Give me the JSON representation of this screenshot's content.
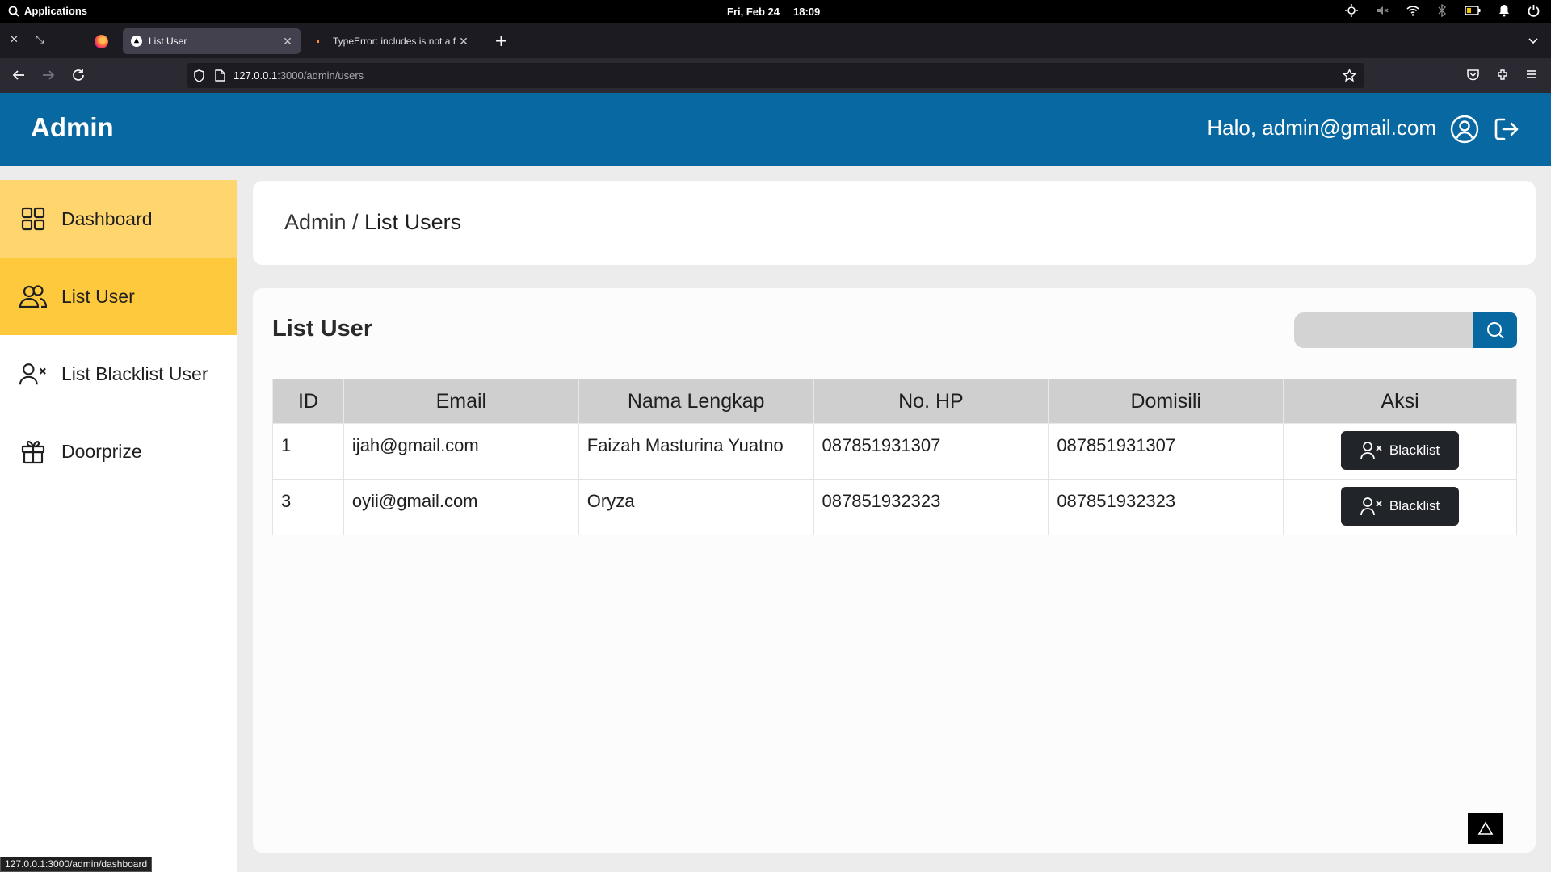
{
  "os": {
    "apps_label": "Applications",
    "date": "Fri, Feb 24",
    "time": "18:09"
  },
  "browser": {
    "tabs": [
      {
        "title": "List User"
      },
      {
        "title": "TypeError: includes is not a fu"
      }
    ],
    "url_host": "127.0.0.1",
    "url_path": ":3000/admin/users",
    "status_url": "127.0.0.1:3000/admin/dashboard"
  },
  "header": {
    "brand": "Admin",
    "greeting": "Halo, admin@gmail.com"
  },
  "sidebar": {
    "items": [
      {
        "label": "Dashboard",
        "icon": "grid-icon"
      },
      {
        "label": "List User",
        "icon": "users-icon"
      },
      {
        "label": "List Blacklist User",
        "icon": "user-x-icon"
      },
      {
        "label": "Doorprize",
        "icon": "gift-icon"
      }
    ]
  },
  "breadcrumb": {
    "root": "Admin / ",
    "current": "List Users"
  },
  "main": {
    "title": "List User",
    "search_placeholder": "",
    "table": {
      "headers": [
        "ID",
        "Email",
        "Nama Lengkap",
        "No. HP",
        "Domisili",
        "Aksi"
      ],
      "rows": [
        {
          "id": "1",
          "email": "ijah@gmail.com",
          "name": "Faizah Masturina Yuatno",
          "phone": "087851931307",
          "domisili": "087851931307",
          "action": "Blacklist"
        },
        {
          "id": "3",
          "email": "oyii@gmail.com",
          "name": "Oryza",
          "phone": "087851932323",
          "domisili": "087851932323",
          "action": "Blacklist"
        }
      ]
    }
  },
  "colors": {
    "primary": "#0868a1",
    "sidebar_active": "#ffc93d",
    "sidebar_hover": "#ffd66e",
    "button_dark": "#212529"
  }
}
